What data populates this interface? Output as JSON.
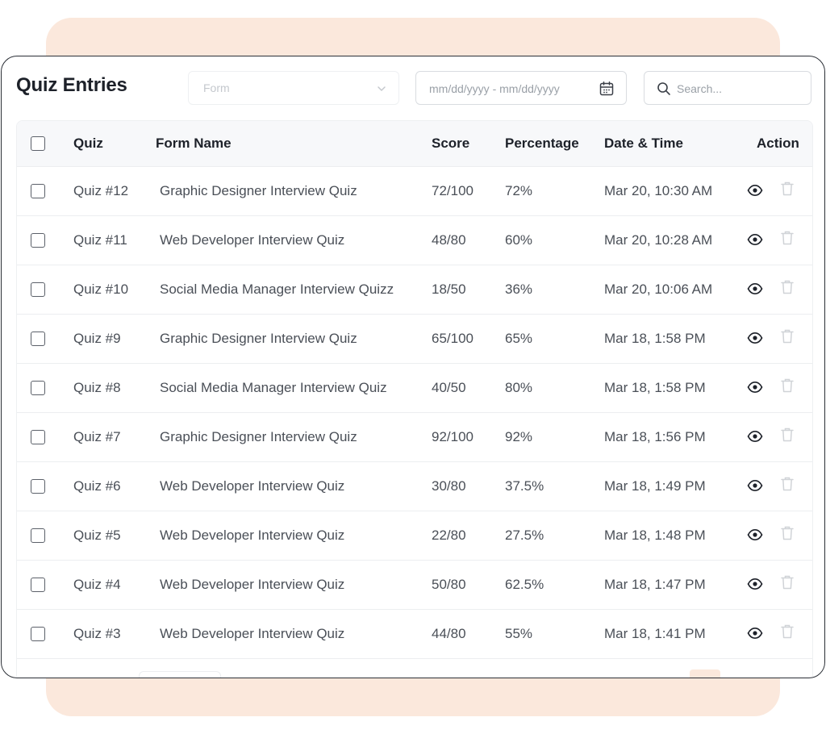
{
  "page": {
    "title": "Quiz Entries"
  },
  "filters": {
    "form_select": {
      "value": "Form"
    },
    "date_range": {
      "placeholder": "mm/dd/yyyy - mm/dd/yyyy"
    },
    "search": {
      "placeholder": "Search..."
    }
  },
  "table": {
    "headers": {
      "quiz": "Quiz",
      "form_name": "Form Name",
      "score": "Score",
      "percentage": "Percentage",
      "date_time": "Date & Time",
      "action": "Action"
    },
    "rows": [
      {
        "quiz": "Quiz #12",
        "form_name": "Graphic Designer Interview Quiz",
        "score": "72/100",
        "percentage": "72%",
        "date_time": "Mar 20, 10:30 AM"
      },
      {
        "quiz": "Quiz #11",
        "form_name": "Web Developer Interview Quiz",
        "score": "48/80",
        "percentage": "60%",
        "date_time": "Mar 20, 10:28 AM"
      },
      {
        "quiz": "Quiz #10",
        "form_name": "Social Media Manager Interview Quizz",
        "score": "18/50",
        "percentage": "36%",
        "date_time": "Mar 20, 10:06 AM"
      },
      {
        "quiz": "Quiz #9",
        "form_name": "Graphic Designer Interview Quiz",
        "score": "65/100",
        "percentage": "65%",
        "date_time": "Mar 18, 1:58 PM"
      },
      {
        "quiz": "Quiz #8",
        "form_name": "Social Media Manager Interview Quiz",
        "score": "40/50",
        "percentage": "80%",
        "date_time": "Mar 18, 1:58 PM"
      },
      {
        "quiz": "Quiz #7",
        "form_name": "Graphic Designer Interview Quiz",
        "score": "92/100",
        "percentage": "92%",
        "date_time": "Mar 18, 1:56 PM"
      },
      {
        "quiz": "Quiz #6",
        "form_name": "Web Developer Interview Quiz",
        "score": "30/80",
        "percentage": "37.5%",
        "date_time": "Mar 18, 1:49 PM"
      },
      {
        "quiz": "Quiz #5",
        "form_name": "Web Developer Interview Quiz",
        "score": "22/80",
        "percentage": "27.5%",
        "date_time": "Mar 18, 1:48 PM"
      },
      {
        "quiz": "Quiz #4",
        "form_name": "Web Developer Interview Quiz",
        "score": "50/80",
        "percentage": "62.5%",
        "date_time": "Mar 18, 1:47 PM"
      },
      {
        "quiz": "Quiz #3",
        "form_name": "Web Developer Interview Quiz",
        "score": "44/80",
        "percentage": "55%",
        "date_time": "Mar 18, 1:41 PM"
      }
    ]
  },
  "icons": {
    "select_chevron": "chevron-down-icon",
    "date": "calendar-icon",
    "search": "search-icon",
    "view": "eye-icon",
    "delete": "trash-icon"
  },
  "colors": {
    "backdrop": "#fbe8dc",
    "panel_border": "#2b2f36",
    "header_bg": "#f7f8fa",
    "title": "#1d2129",
    "text": "#4a4f57",
    "muted_icon": "#d0d3d7"
  }
}
